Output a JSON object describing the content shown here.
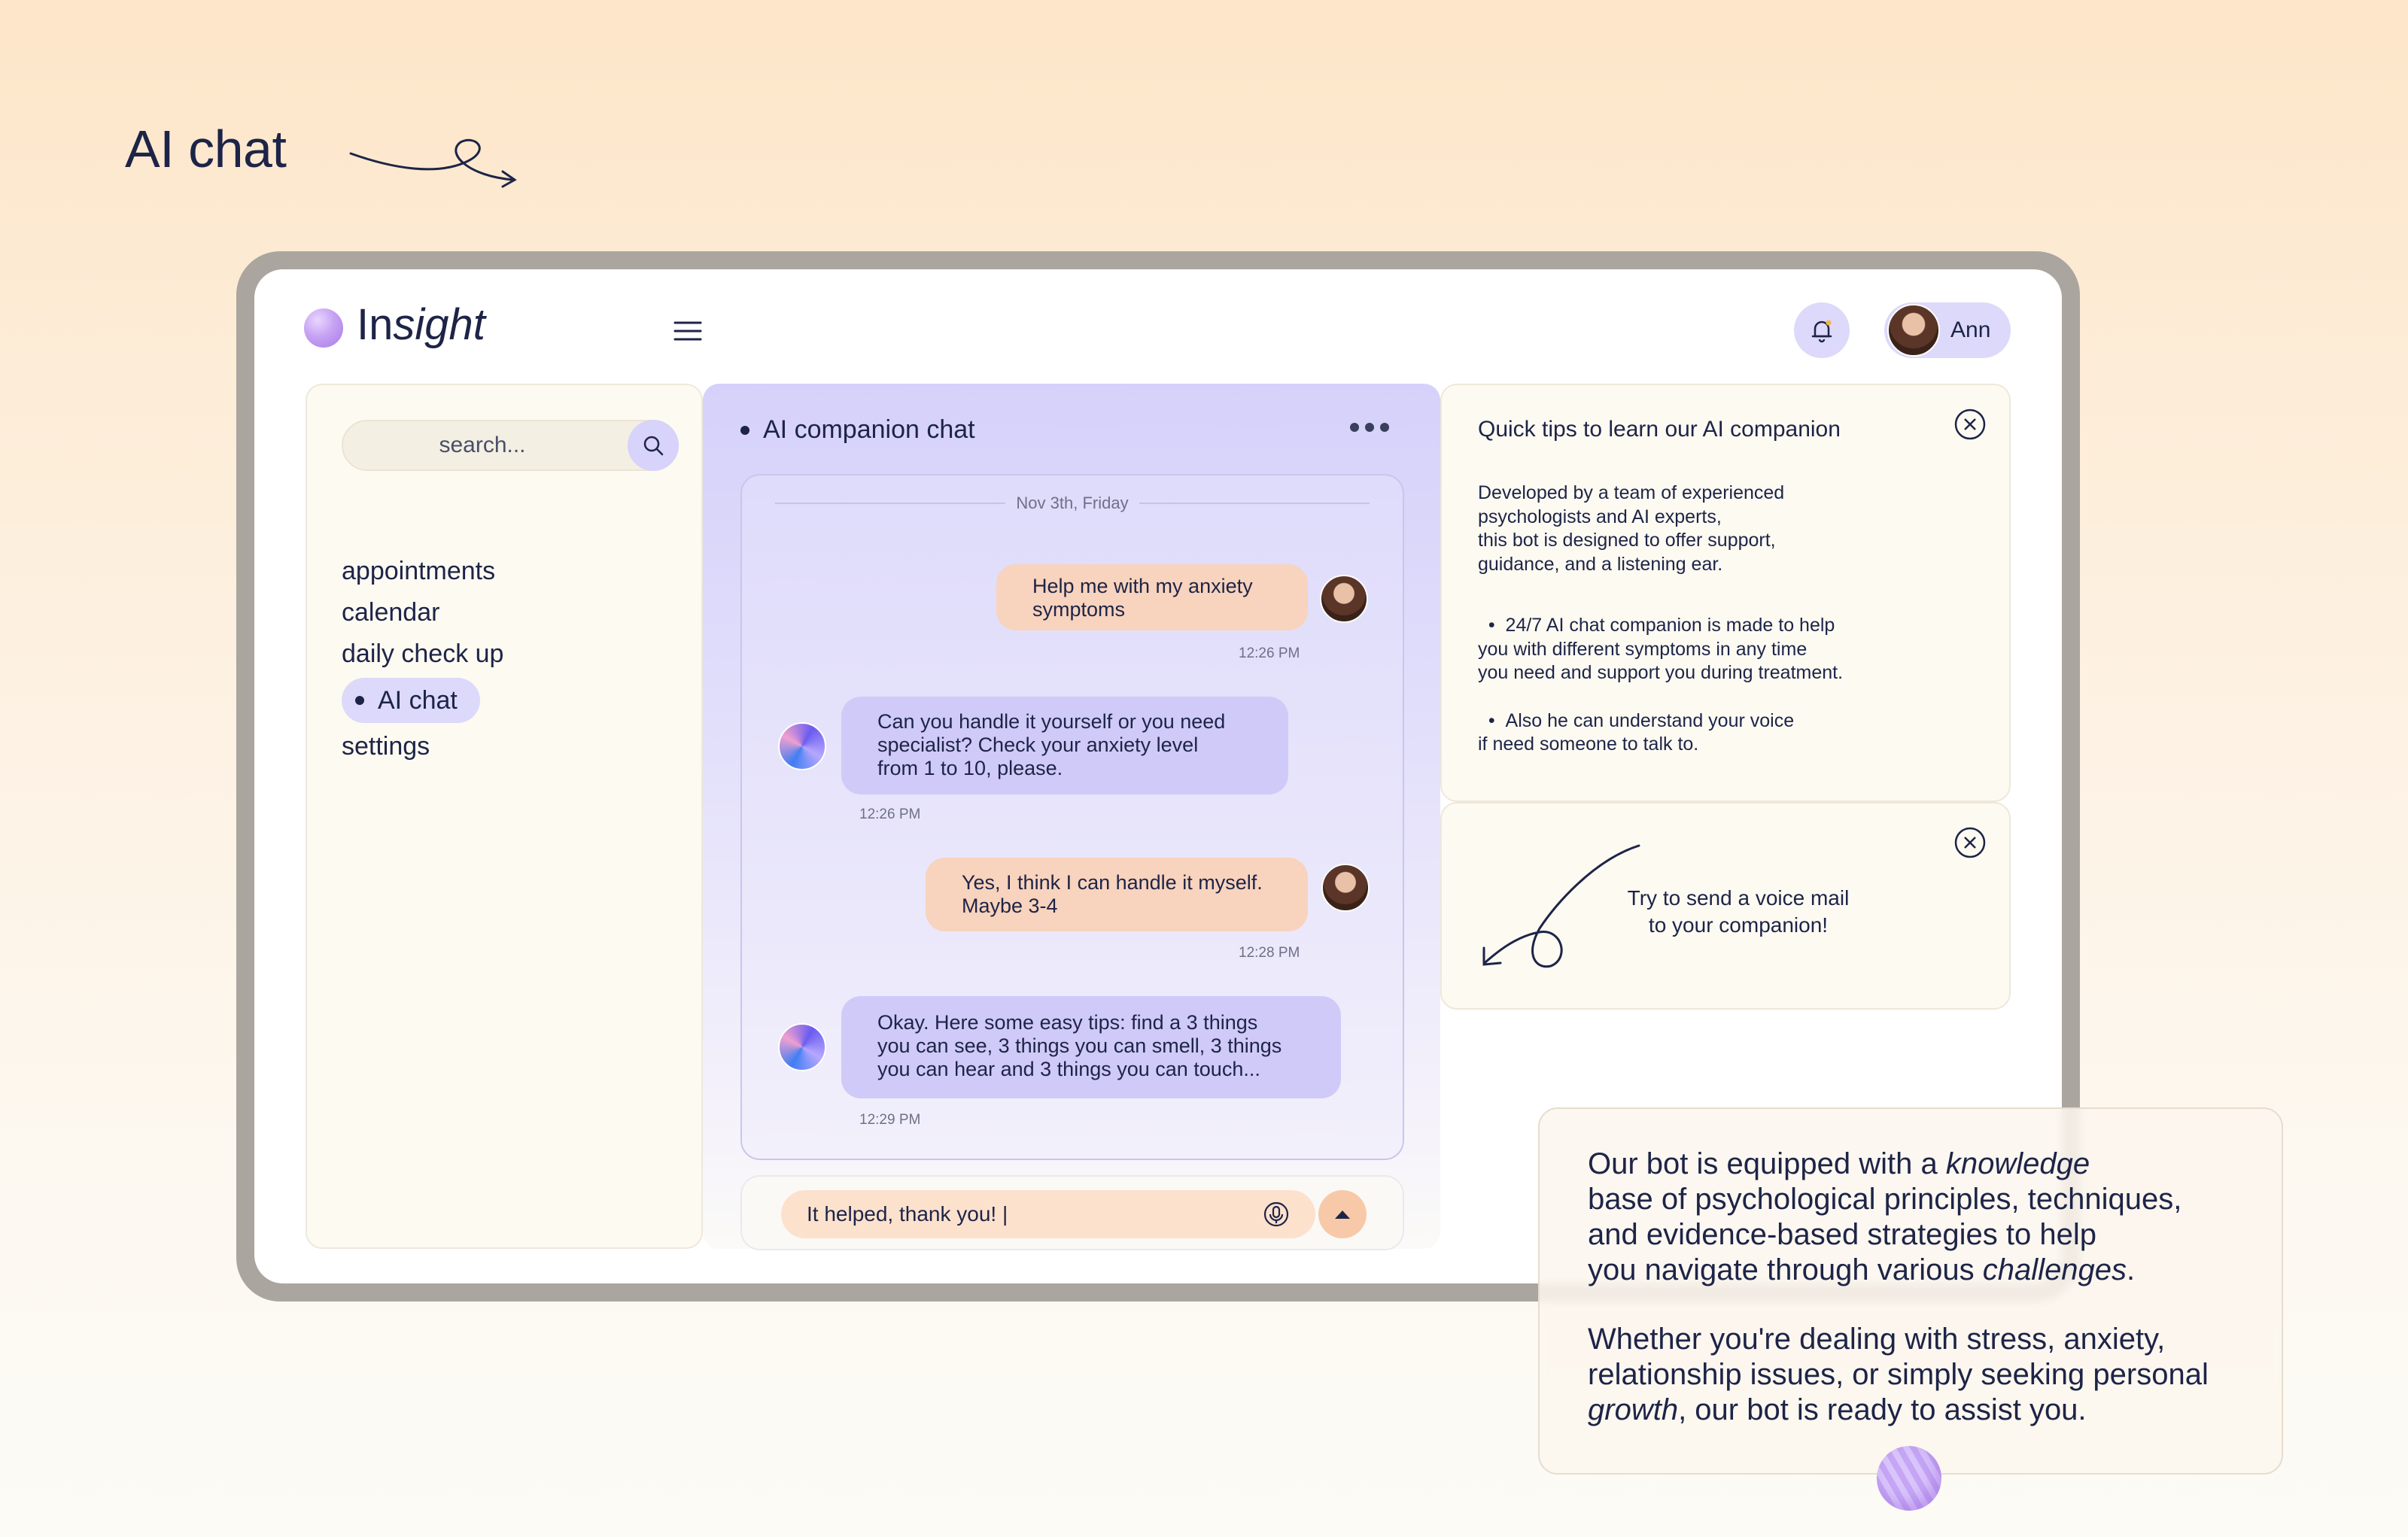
{
  "page": {
    "title": "AI chat"
  },
  "header": {
    "logo": {
      "prefix": "In",
      "suffix": "sight"
    },
    "user": {
      "name": "Ann"
    }
  },
  "sidebar": {
    "search": {
      "placeholder": "search..."
    },
    "items": [
      {
        "label": "appointments",
        "active": false
      },
      {
        "label": "calendar",
        "active": false
      },
      {
        "label": "daily check up",
        "active": false
      },
      {
        "label": "AI chat",
        "active": true
      },
      {
        "label": "settings",
        "active": false
      }
    ]
  },
  "chat": {
    "title": "AI companion chat",
    "date": "Nov 3th, Friday",
    "messages": [
      {
        "from": "user",
        "lines": [
          "Help me with my anxiety",
          "symptoms"
        ],
        "time": "12:26 PM"
      },
      {
        "from": "bot",
        "lines": [
          "Can you handle it yourself or you need",
          "specialist? Check your anxiety level",
          "from 1 to 10, please."
        ],
        "time": "12:26 PM"
      },
      {
        "from": "user",
        "lines": [
          "Yes, I think I can handle it myself.",
          "Maybe 3-4"
        ],
        "time": "12:28 PM"
      },
      {
        "from": "bot",
        "lines": [
          "Okay. Here some easy tips: find a 3 things",
          "you can see, 3 things you can smell, 3 things",
          "you can hear and 3 things you can touch..."
        ],
        "time": "12:29 PM"
      }
    ],
    "composer": {
      "value": "It helped, thank you! |"
    }
  },
  "tips": {
    "title": "Quick tips to learn our AI companion",
    "intro": [
      "Developed by a team of experienced",
      "psychologists and AI experts,",
      "this bot is designed to offer support,",
      "guidance, and a listening ear."
    ],
    "bullet1": [
      "24/7 AI chat companion is made to help",
      "you with different symptoms in any time",
      "you need and support you during treatment."
    ],
    "bullet2": [
      "Also he can understand your voice",
      "if need someone to talk to."
    ]
  },
  "voice_tip": {
    "lines": [
      "Try to send a voice mail",
      "to your companion!"
    ]
  },
  "info": {
    "p1_a": "Our bot is equipped with a ",
    "p1_em1": "knowledge",
    "p1_b": "base of psychological principles, techniques,",
    "p1_c": "and evidence-based strategies to help",
    "p1_d": "you navigate through various ",
    "p1_em2": "challenges",
    "p1_e": ".",
    "p2_a": "Whether you're dealing with stress, anxiety,",
    "p2_b": "relationship issues, or simply seeking personal",
    "p2_em": "growth",
    "p2_c": ", our bot is ready to assist you."
  },
  "colors": {
    "accent_lavender": "#dcd9fb",
    "user_bubble": "#f8d3bd",
    "bot_bubble": "#cfcaf8",
    "text_navy": "#1d2447"
  }
}
